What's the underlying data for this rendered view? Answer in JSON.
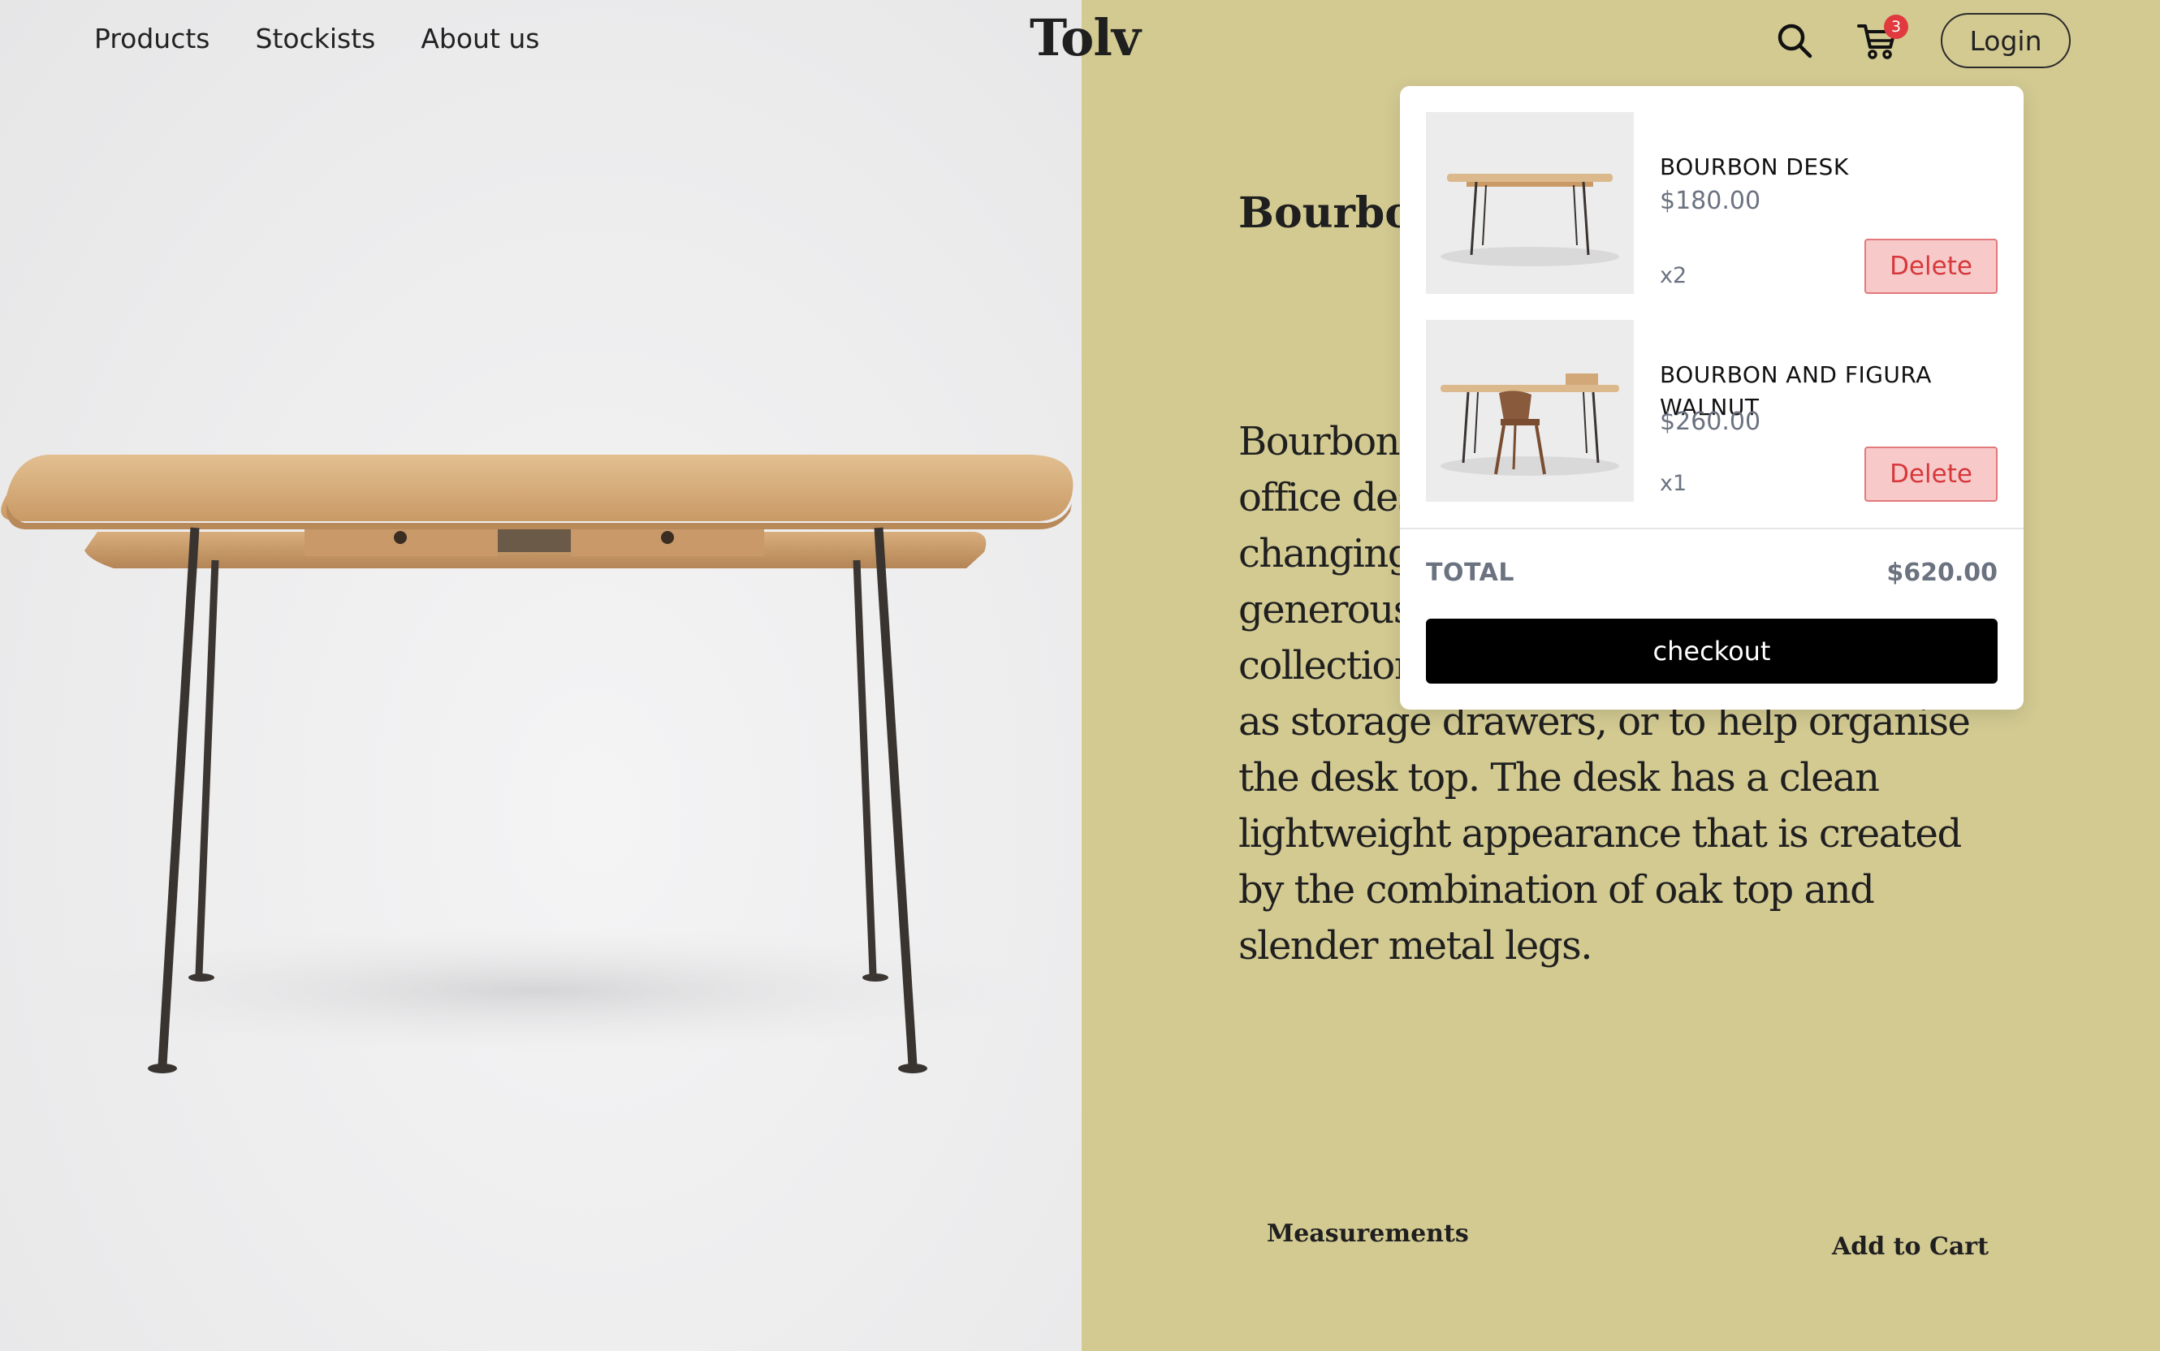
{
  "nav": {
    "products": "Products",
    "stockists": "Stockists",
    "about": "About us"
  },
  "brand": {
    "logo": "Tolv"
  },
  "header": {
    "search_icon": "search-icon",
    "cart_icon": "cart-icon",
    "cart_count": "3",
    "login_label": "Login"
  },
  "product": {
    "title": "Bourbon Desk",
    "description": "Bourbon is a well proportioned home office desk that responds to the changing way people work, providing a generous writing surface and a useful collection of oak trays that can be used as storage drawers, or to help organise the desk top. The desk has a clean lightweight appearance that is created by the combination of oak top and slender metal legs.",
    "measurements_label": "Measurements",
    "add_to_cart_label": "Add to Cart"
  },
  "cart": {
    "items": [
      {
        "name": "BOURBON DESK",
        "price": "$180.00",
        "qty": "x2",
        "delete_label": "Delete"
      },
      {
        "name": "BOURBON AND FIGURA WALNUT",
        "price": "$260.00",
        "qty": "x1",
        "delete_label": "Delete"
      }
    ],
    "total_label": "TOTAL",
    "total_value": "$620.00",
    "checkout_label": "checkout"
  },
  "colors": {
    "right_panel": "#d3ca92",
    "badge": "#e03a3e",
    "delete_bg": "#f7c9c9",
    "delete_text": "#d6383c",
    "checkout_bg": "#000000"
  }
}
